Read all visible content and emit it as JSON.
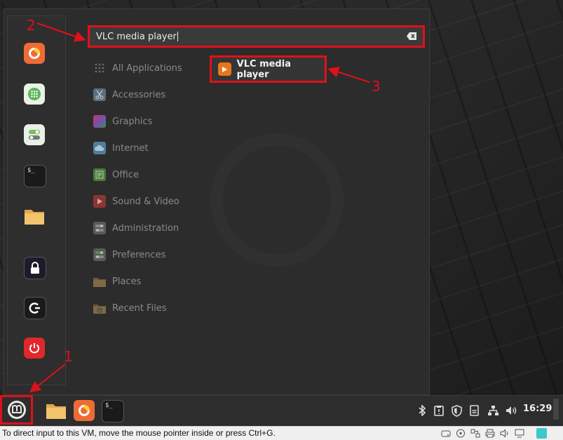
{
  "search": {
    "value": "VLC media player"
  },
  "categories": [
    {
      "label": "All Applications",
      "icon": "grid-icon"
    },
    {
      "label": "Accessories",
      "icon": "scissors-icon"
    },
    {
      "label": "Graphics",
      "icon": "graphics-icon"
    },
    {
      "label": "Internet",
      "icon": "cloud-icon"
    },
    {
      "label": "Office",
      "icon": "office-icon"
    },
    {
      "label": "Sound & Video",
      "icon": "play-icon"
    },
    {
      "label": "Administration",
      "icon": "toggle-icon"
    },
    {
      "label": "Preferences",
      "icon": "preferences-icon"
    },
    {
      "label": "Places",
      "icon": "folder-icon"
    },
    {
      "label": "Recent Files",
      "icon": "recent-folder-icon"
    }
  ],
  "result": {
    "label": "VLC media player",
    "icon": "vlc-icon"
  },
  "favorites": [
    "firefox-icon",
    "dial-icon",
    "settings-icon",
    "terminal-icon",
    "folder-icon",
    "lock-icon",
    "logout-icon",
    "power-icon"
  ],
  "annotations": {
    "one": "1",
    "two": "2",
    "three": "3"
  },
  "taskbar": {
    "clock": "16:29",
    "apps": [
      "folder-icon",
      "firefox-icon",
      "terminal-icon"
    ]
  },
  "statusbar": {
    "text": "To direct input to this VM, move the mouse pointer inside or press Ctrl+G."
  },
  "colors": {
    "annotation": "#e0101a",
    "vlc": "#e8761c",
    "firefox": "#ef6b35",
    "power": "#e0282b"
  }
}
